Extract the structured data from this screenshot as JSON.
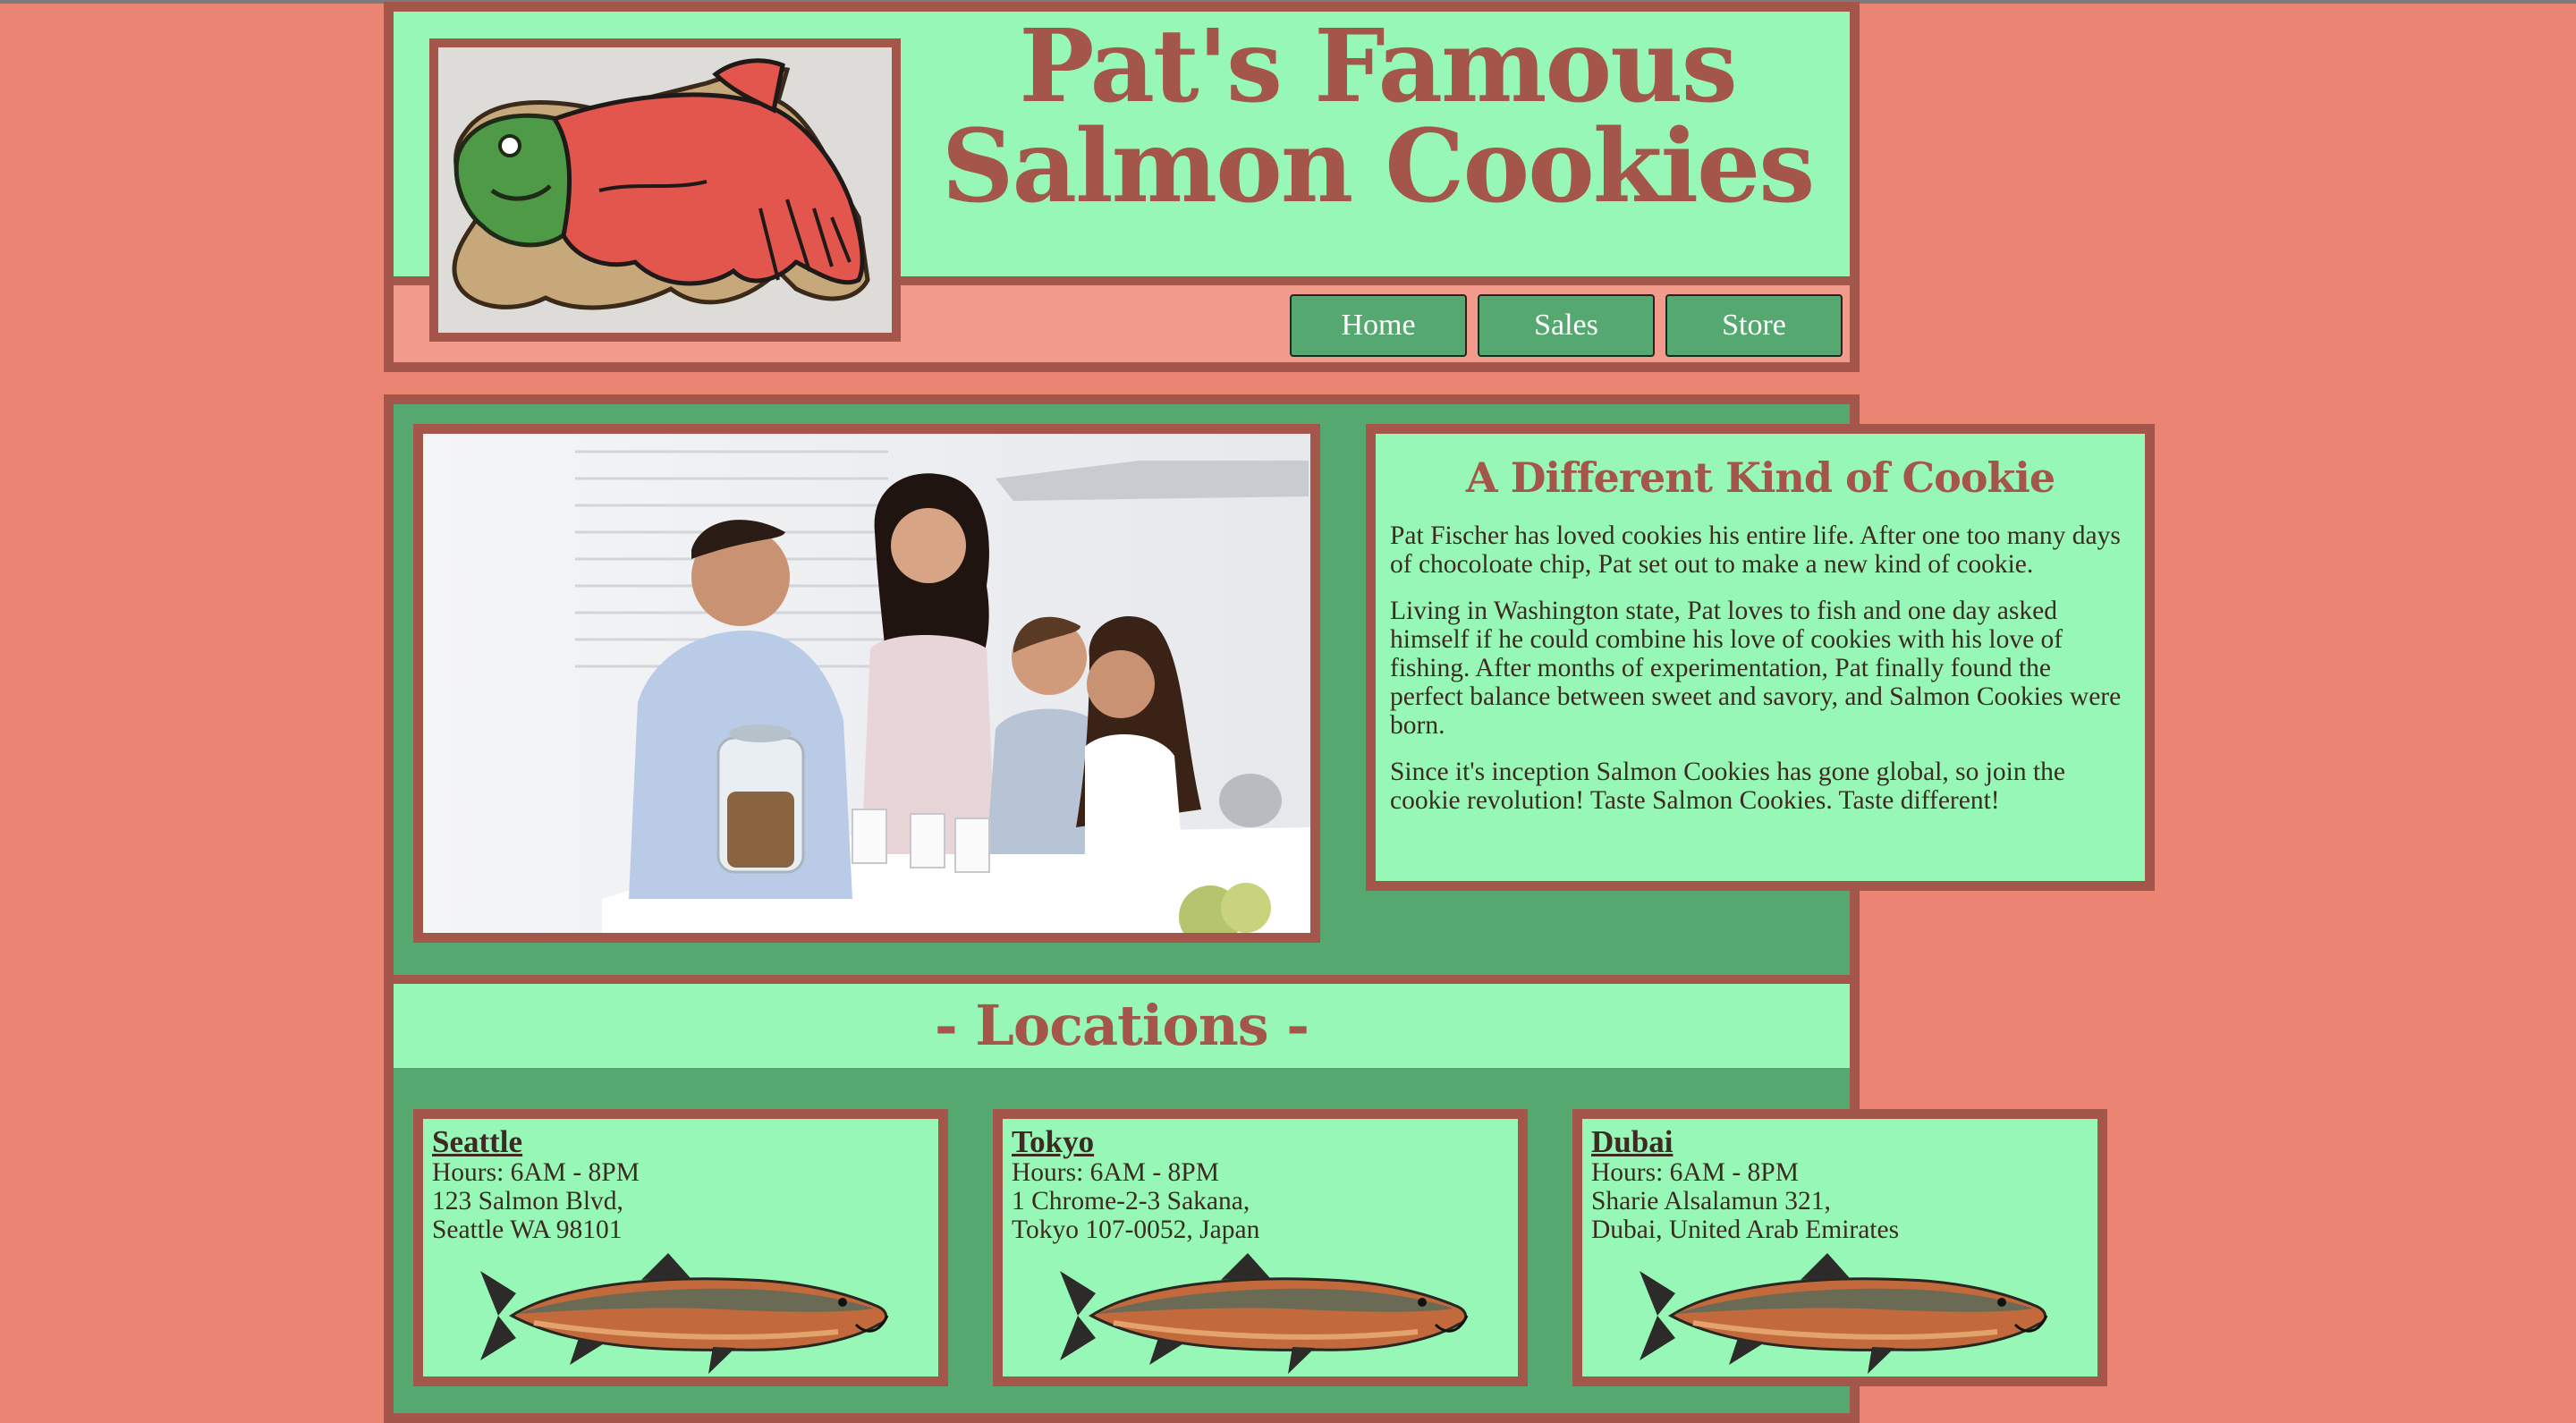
{
  "header": {
    "title_line1": "Pat's Famous",
    "title_line2": "Salmon Cookies",
    "logo_icon": "salmon-cookie-image"
  },
  "nav": {
    "items": [
      {
        "label": "Home"
      },
      {
        "label": "Sales"
      },
      {
        "label": "Store"
      }
    ]
  },
  "about": {
    "photo_icon": "family-photo",
    "heading": "A Different Kind of Cookie",
    "paragraphs": [
      "Pat Fischer has loved cookies his entire life. After one too many days of chocoloate chip, Pat set out to make a new kind of cookie.",
      "Living in Washington state, Pat loves to fish and one day asked himself if he could combine his love of cookies with his love of fishing. After months of experimentation, Pat finally found the perfect balance between sweet and savory, and Salmon Cookies were born.",
      "Since it's inception Salmon Cookies has gone global, so join the cookie revolution! Taste Salmon Cookies. Taste different!"
    ]
  },
  "locations": {
    "heading": "- Locations -",
    "items": [
      {
        "city": "Seattle",
        "hours": "Hours: 6AM - 8PM",
        "address1": "123 Salmon Blvd,",
        "address2": "Seattle WA 98101"
      },
      {
        "city": "Tokyo",
        "hours": "Hours: 6AM - 8PM",
        "address1": "1 Chrome-2-3 Sakana,",
        "address2": "Tokyo 107-0052, Japan"
      },
      {
        "city": "Dubai",
        "hours": "Hours: 6AM - 8PM",
        "address1": "Sharie Alsalamun 321,",
        "address2": "Dubai, United Arab Emirates"
      }
    ]
  },
  "colors": {
    "background": "#ec8474",
    "border": "#a4564a",
    "light_green": "#97f7b6",
    "dark_green": "#55a870",
    "header_strip": "#f29b8d"
  }
}
